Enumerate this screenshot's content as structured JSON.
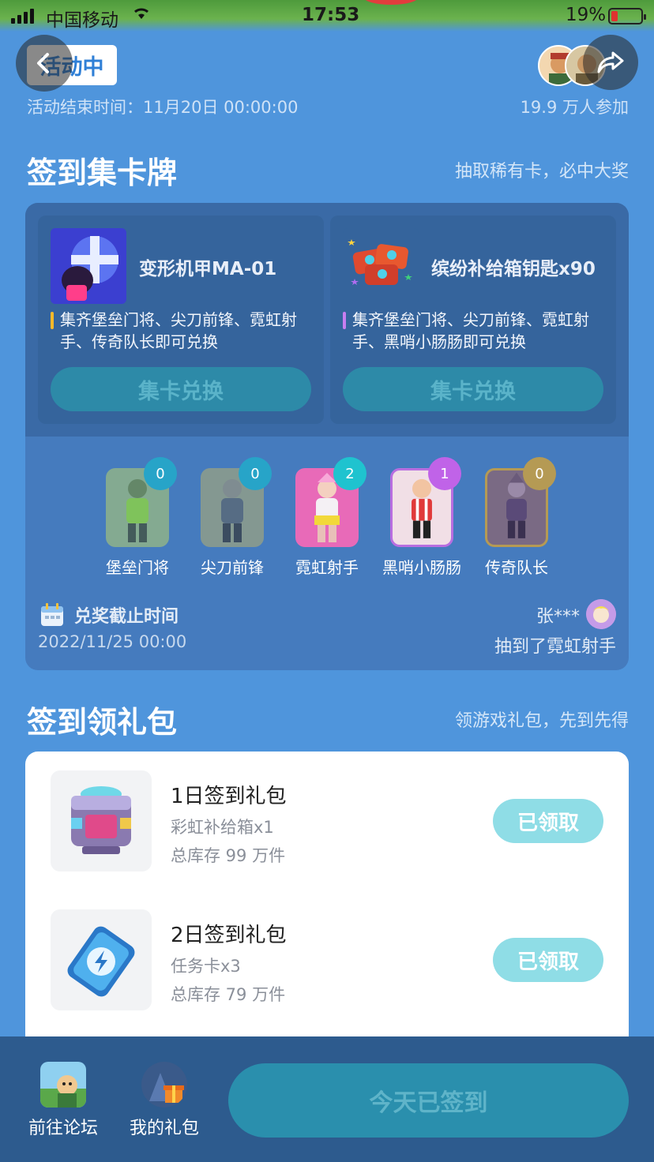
{
  "status_bar": {
    "carrier": "中国移动",
    "time": "17:53",
    "battery": "19%",
    "icons": [
      "signal-icon",
      "wifi-icon",
      "battery-icon"
    ]
  },
  "header": {
    "status_badge": "活动中",
    "end_time": "活动结束时间：11月20日 00:00:00",
    "participants": "19.9 万人参加",
    "icons": [
      "back-icon",
      "share-icon"
    ]
  },
  "cards_section": {
    "title": "签到集卡牌",
    "subtitle": "抽取稀有卡，必中大奖",
    "prizes": [
      {
        "name": "变形机甲MA-01",
        "condition": "集齐堡垒门将、尖刀前锋、霓虹射手、传奇队长即可兑换",
        "button": "集卡兑换",
        "accent": "#f5b92a"
      },
      {
        "name": "缤纷补给箱钥匙x90",
        "condition": "集齐堡垒门将、尖刀前锋、霓虹射手、黑哨小肠肠即可兑换",
        "button": "集卡兑换",
        "accent": "#c77ef0"
      }
    ],
    "characters": [
      {
        "name": "堡垒门将",
        "count": "0",
        "color": "#27a4c8"
      },
      {
        "name": "尖刀前锋",
        "count": "0",
        "color": "#27a4c8"
      },
      {
        "name": "霓虹射手",
        "count": "2",
        "color": "#1fc3cf"
      },
      {
        "name": "黑哨小肠肠",
        "count": "1",
        "color": "#c063e8"
      },
      {
        "name": "传奇队长",
        "count": "0",
        "color": "#b59a54"
      }
    ],
    "deadline_label": "兑奖截止时间",
    "deadline_value": "2022/11/25 00:00",
    "winner_name": "张***",
    "winner_text": "抽到了霓虹射手"
  },
  "gifts_section": {
    "title": "签到领礼包",
    "subtitle": "领游戏礼包，先到先得",
    "items": [
      {
        "title": "1日签到礼包",
        "item": "彩虹补给箱x1",
        "stock": "总库存 99 万件",
        "button": "已领取"
      },
      {
        "title": "2日签到礼包",
        "item": "任务卡x3",
        "stock": "总库存 79 万件",
        "button": "已领取"
      }
    ]
  },
  "bottom_bar": {
    "forum_label": "前往论坛",
    "gifts_label": "我的礼包",
    "checkin_button": "今天已签到"
  }
}
